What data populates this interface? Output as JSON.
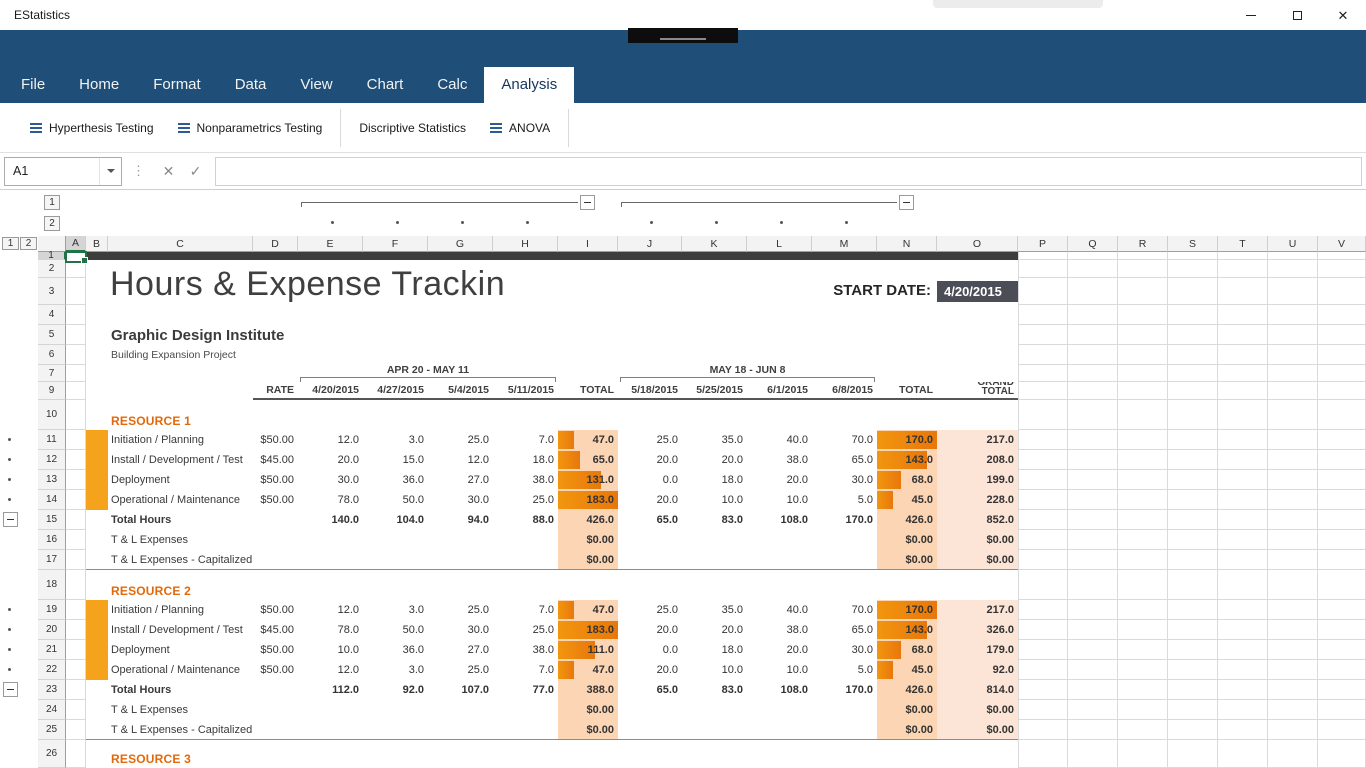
{
  "window": {
    "title": "EStatistics",
    "controls": {
      "close": "✕"
    }
  },
  "menu": {
    "items": [
      "File",
      "Home",
      "Format",
      "Data",
      "View",
      "Chart",
      "Calc",
      "Analysis"
    ],
    "active_item": "Analysis"
  },
  "toolbar": {
    "buttons": [
      {
        "label": "Hyperthesis Testing",
        "icon": "list-icon"
      },
      {
        "label": "Nonparametrics Testing",
        "icon": "list-icon"
      },
      {
        "label": "Discriptive Statistics",
        "icon": null
      },
      {
        "label": "ANOVA",
        "icon": "list-icon"
      }
    ]
  },
  "formula_bar": {
    "name_box": "A1",
    "formula": "",
    "cancel_icon": "✕",
    "confirm_icon": "✓",
    "menu_dots": "⋮"
  },
  "outline": {
    "levels": [
      "1",
      "2"
    ]
  },
  "sheet": {
    "selected_cell": "A1",
    "columns": [
      "A",
      "B",
      "C",
      "D",
      "E",
      "F",
      "G",
      "H",
      "I",
      "J",
      "K",
      "L",
      "M",
      "N",
      "O",
      "P",
      "Q",
      "R",
      "S",
      "T",
      "U",
      "V"
    ],
    "rows_visible": [
      1,
      2,
      3,
      4,
      5,
      6,
      7,
      9,
      10,
      11,
      12,
      13,
      14,
      15,
      16,
      17,
      18,
      19,
      20,
      21,
      22,
      23,
      24,
      25,
      26
    ],
    "doc": {
      "title": "Hours & Expense Trackin",
      "start_date_label": "START DATE:",
      "start_date_value": "4/20/2015",
      "company": "Graphic Design Institute",
      "project": "Building Expansion Project",
      "period1": "APR 20 - MAY 11",
      "period2": "MAY 18 - JUN 8",
      "rate_header": "RATE",
      "week1_dates": [
        "4/20/2015",
        "4/27/2015",
        "5/4/2015",
        "5/11/2015"
      ],
      "week2_dates": [
        "5/18/2015",
        "5/25/2015",
        "6/1/2015",
        "6/8/2015"
      ],
      "total_header": "TOTAL",
      "grand_total_header": "GRAND TOTAL",
      "total_hours_label": "Total Hours",
      "expense_labels": [
        "T & L Expenses",
        "T & L Expenses - Capitalized"
      ],
      "resources": [
        {
          "name": "RESOURCE 1",
          "tasks": [
            {
              "label": "Initiation / Planning",
              "rate": "$50.00",
              "week1": [
                "12.0",
                "3.0",
                "25.0",
                "7.0"
              ],
              "total1": "47.0",
              "week2": [
                "25.0",
                "35.0",
                "40.0",
                "70.0"
              ],
              "total2": "170.0",
              "grand": "217.0"
            },
            {
              "label": "Install / Development / Test",
              "rate": "$45.00",
              "week1": [
                "20.0",
                "15.0",
                "12.0",
                "18.0"
              ],
              "total1": "65.0",
              "week2": [
                "20.0",
                "20.0",
                "38.0",
                "65.0"
              ],
              "total2": "143.0",
              "grand": "208.0"
            },
            {
              "label": "Deployment",
              "rate": "$50.00",
              "week1": [
                "30.0",
                "36.0",
                "27.0",
                "38.0"
              ],
              "total1": "131.0",
              "week2": [
                "0.0",
                "18.0",
                "20.0",
                "30.0"
              ],
              "total2": "68.0",
              "grand": "199.0"
            },
            {
              "label": "Operational / Maintenance",
              "rate": "$50.00",
              "week1": [
                "78.0",
                "50.0",
                "30.0",
                "25.0"
              ],
              "total1": "183.0",
              "week2": [
                "20.0",
                "10.0",
                "10.0",
                "5.0"
              ],
              "total2": "45.0",
              "grand": "228.0"
            }
          ],
          "total_hours": {
            "week1": [
              "140.0",
              "104.0",
              "94.0",
              "88.0"
            ],
            "total1": "426.0",
            "week2": [
              "65.0",
              "83.0",
              "108.0",
              "170.0"
            ],
            "total2": "426.0",
            "grand": "852.0"
          },
          "expenses": [
            {
              "total1": "$0.00",
              "total2": "$0.00",
              "grand": "$0.00"
            },
            {
              "total1": "$0.00",
              "total2": "$0.00",
              "grand": "$0.00"
            }
          ]
        },
        {
          "name": "RESOURCE 2",
          "tasks": [
            {
              "label": "Initiation / Planning",
              "rate": "$50.00",
              "week1": [
                "12.0",
                "3.0",
                "25.0",
                "7.0"
              ],
              "total1": "47.0",
              "week2": [
                "25.0",
                "35.0",
                "40.0",
                "70.0"
              ],
              "total2": "170.0",
              "grand": "217.0"
            },
            {
              "label": "Install / Development / Test",
              "rate": "$45.00",
              "week1": [
                "78.0",
                "50.0",
                "30.0",
                "25.0"
              ],
              "total1": "183.0",
              "week2": [
                "20.0",
                "20.0",
                "38.0",
                "65.0"
              ],
              "total2": "143.0",
              "grand": "326.0"
            },
            {
              "label": "Deployment",
              "rate": "$50.00",
              "week1": [
                "10.0",
                "36.0",
                "27.0",
                "38.0"
              ],
              "total1": "111.0",
              "week2": [
                "0.0",
                "18.0",
                "20.0",
                "30.0"
              ],
              "total2": "68.0",
              "grand": "179.0"
            },
            {
              "label": "Operational / Maintenance",
              "rate": "$50.00",
              "week1": [
                "12.0",
                "3.0",
                "25.0",
                "7.0"
              ],
              "total1": "47.0",
              "week2": [
                "20.0",
                "10.0",
                "10.0",
                "5.0"
              ],
              "total2": "45.0",
              "grand": "92.0"
            }
          ],
          "total_hours": {
            "week1": [
              "112.0",
              "92.0",
              "107.0",
              "77.0"
            ],
            "total1": "388.0",
            "week2": [
              "65.0",
              "83.0",
              "108.0",
              "170.0"
            ],
            "total2": "426.0",
            "grand": "814.0"
          },
          "expenses": [
            {
              "total1": "$0.00",
              "total2": "$0.00",
              "grand": "$0.00"
            },
            {
              "total1": "$0.00",
              "total2": "$0.00",
              "grand": "$0.00"
            }
          ]
        },
        {
          "name": "RESOURCE 3",
          "tasks": [],
          "total_hours": null,
          "expenses": []
        }
      ]
    },
    "colors": {
      "ribbon_blue": "#1F4E79",
      "accent_orange": "#E2690B",
      "resource_bar": "#F5A21C",
      "bar_light": "#FCD5B4",
      "bar_dark": "#E8770C",
      "grand_total_bg": "#FCE4D6",
      "start_date_bg": "#4B4D57",
      "title_bar_dark": "#3D3D3D"
    }
  }
}
